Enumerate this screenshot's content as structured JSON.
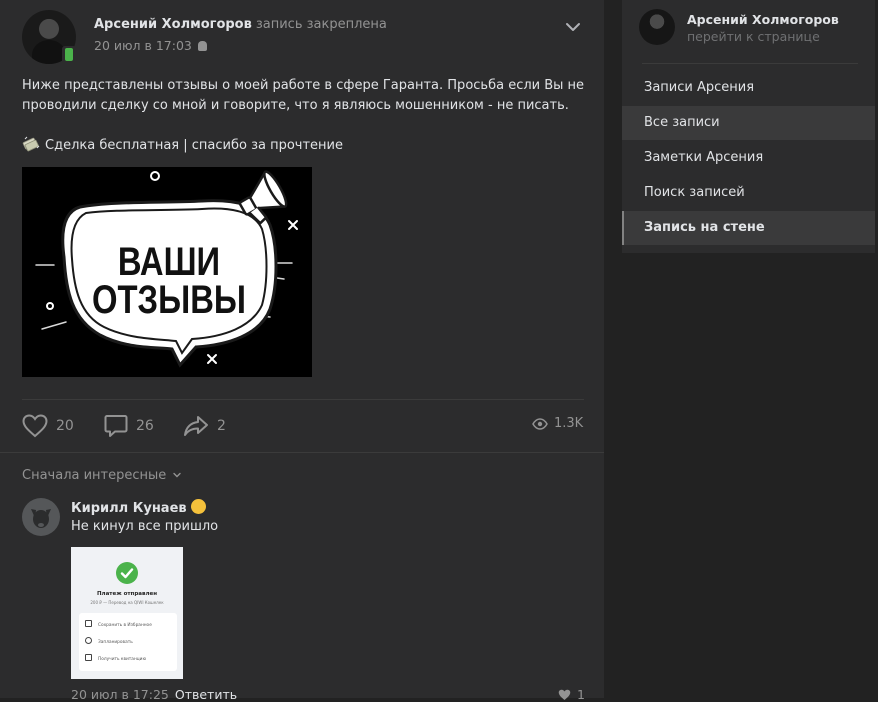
{
  "post": {
    "author": "Арсений Холмогоров",
    "pinned_label": "запись закреплена",
    "date": "20 июл в 17:03",
    "text_line1": "Ниже представлены отзывы о моей работе в сфере Гаранта. Просьба если Вы не",
    "text_line2": "проводили сделку со мной и говорите, что я являюсь мошенником - не писать.",
    "link_text": "Сделка бесплатная | спасибо за прочтение",
    "banner_line1": "ВАШИ",
    "banner_line2": "ОТЗЫВЫ",
    "likes": "20",
    "comments": "26",
    "shares": "2",
    "views": "1.3K"
  },
  "comments": {
    "sort_label": "Сначала интересные",
    "items": [
      {
        "author": "Кирилл Кунаев",
        "text": "Не кинул все пришло",
        "date": "20 июл в 17:25",
        "reply_label": "Ответить",
        "likes": "1",
        "attachment": {
          "title": "Платеж отправлен",
          "subtitle": "200 ₽ — Перевод на QIWI Кошелек",
          "actions": [
            "Сохранить в Избранное",
            "Запланировать",
            "Получить квитанцию"
          ]
        }
      }
    ]
  },
  "sidebar": {
    "profile_name": "Арсений Холмогоров",
    "profile_link": "перейти к странице",
    "items": [
      {
        "label": "Записи Арсения"
      },
      {
        "label": "Все записи"
      },
      {
        "label": "Заметки Арсения"
      },
      {
        "label": "Поиск записей"
      },
      {
        "label": "Запись на стене"
      }
    ]
  },
  "colors": {
    "background": "#222222",
    "panel": "#2c2c2d",
    "text": "#e1e3e6",
    "muted": "#939393",
    "online": "#4bb34b"
  }
}
